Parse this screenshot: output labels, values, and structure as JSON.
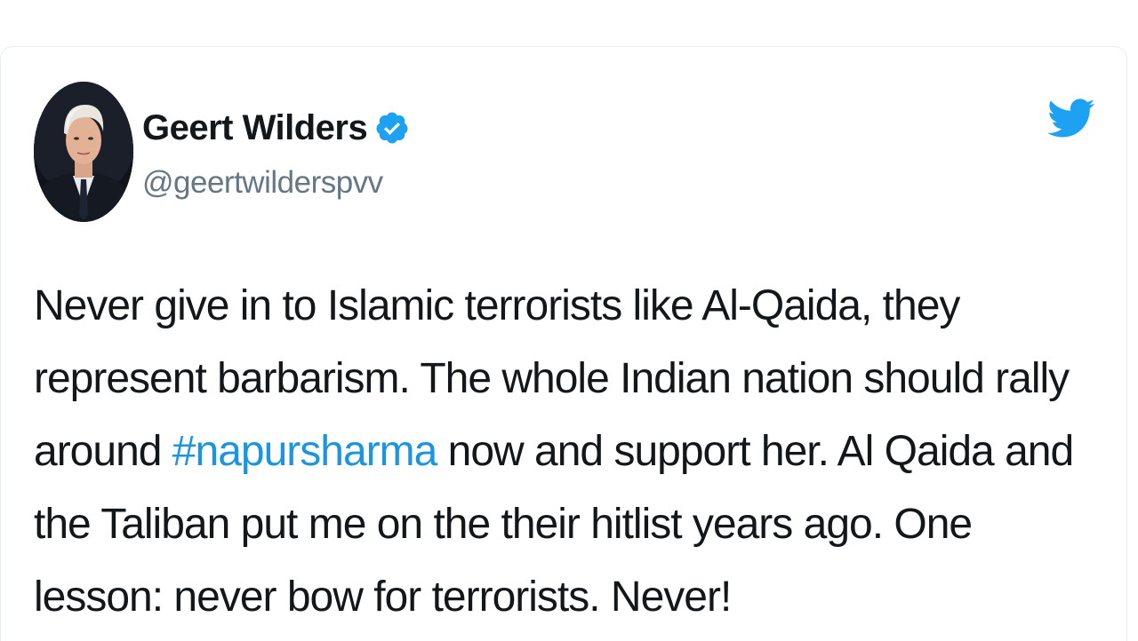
{
  "tweet": {
    "author": {
      "display_name": "Geert Wilders",
      "handle": "@geertwilderspvv",
      "verified": true,
      "verified_icon": "verified-badge-icon",
      "avatar": "profile-photo"
    },
    "text_before_hashtag": "Never give in to Islamic terrorists like Al-Qaida, they represent barbarism. The whole Indian nation should rally around ",
    "hashtag": "#napursharma",
    "text_after_hashtag": " now and support her. Al Qaida and the Taliban put me on the their hitlist years ago. One lesson: never bow for terrorists. Never!",
    "platform_icon": "twitter-bird-icon"
  },
  "colors": {
    "twitter_blue": "#1da1f2",
    "hashtag_blue": "#1b95e0",
    "text_primary": "#14171a",
    "text_secondary": "#657786"
  }
}
